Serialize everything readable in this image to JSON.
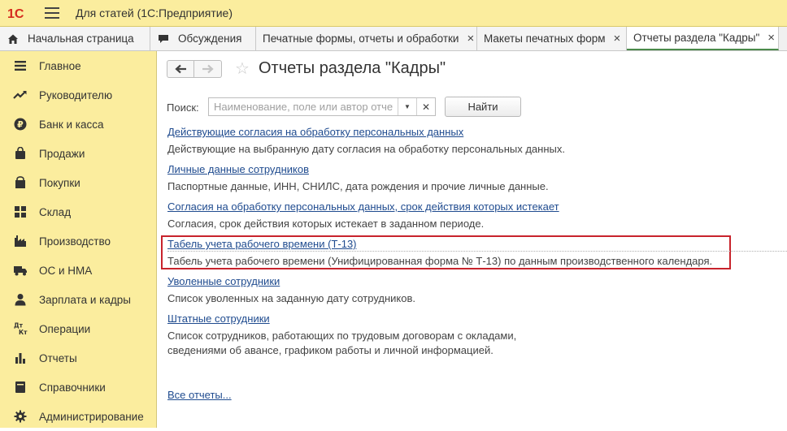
{
  "app": {
    "title": "Для статей  (1С:Предприятие)",
    "logo_text": "1С",
    "colors": {
      "accent": "#fbed9e",
      "link": "#1f4b8f",
      "highlight": "#c8232c",
      "active_tab": "#4a8a4a",
      "logo": "#d52b1e"
    }
  },
  "tabs": [
    {
      "label": "Начальная страница",
      "icon": "home-icon",
      "closable": false,
      "active": false
    },
    {
      "label": "Обсуждения",
      "icon": "chat-icon",
      "closable": false,
      "active": false
    },
    {
      "label": "Печатные формы, отчеты и обработки",
      "closable": true,
      "active": false
    },
    {
      "label": "Макеты печатных форм",
      "closable": true,
      "active": false
    },
    {
      "label": "Отчеты раздела \"Кадры\"",
      "closable": true,
      "active": true
    }
  ],
  "sidebar": {
    "items": [
      {
        "label": "Главное",
        "icon": "list-icon"
      },
      {
        "label": "Руководителю",
        "icon": "trend-icon"
      },
      {
        "label": "Банк и касса",
        "icon": "ruble-icon"
      },
      {
        "label": "Продажи",
        "icon": "bag-icon"
      },
      {
        "label": "Покупки",
        "icon": "cart-icon"
      },
      {
        "label": "Склад",
        "icon": "grid-icon"
      },
      {
        "label": "Производство",
        "icon": "factory-icon"
      },
      {
        "label": "ОС и НМА",
        "icon": "truck-icon"
      },
      {
        "label": "Зарплата и кадры",
        "icon": "person-icon"
      },
      {
        "label": "Операции",
        "icon": "dt-kt-icon",
        "icon_text_top": "Дт",
        "icon_text_bottom": "Кт"
      },
      {
        "label": "Отчеты",
        "icon": "bar-chart-icon"
      },
      {
        "label": "Справочники",
        "icon": "book-icon"
      },
      {
        "label": "Администрирование",
        "icon": "gear-icon"
      }
    ]
  },
  "page": {
    "title": "Отчеты раздела \"Кадры\"",
    "search": {
      "label": "Поиск:",
      "placeholder": "Наименование, поле или автор отчета",
      "value": "",
      "find_button": "Найти"
    },
    "reports": [
      {
        "title": "Действующие согласия на обработку персональных данных",
        "description": "Действующие на выбранную дату согласия на обработку персональных данных."
      },
      {
        "title": "Личные данные сотрудников",
        "description": "Паспортные данные, ИНН, СНИЛС, дата рождения и прочие личные данные."
      },
      {
        "title": "Согласия на обработку персональных данных, срок действия которых истекает",
        "description": "Согласия, срок действия которых истекает в заданном периоде."
      },
      {
        "title": "Табель учета рабочего времени (Т-13)",
        "description": "Табель учета рабочего времени (Унифицированная форма № Т-13) по данным производственного календаря.",
        "highlighted": true
      },
      {
        "title": "Уволенные сотрудники",
        "description": "Список уволенных на заданную дату сотрудников."
      },
      {
        "title": "Штатные сотрудники",
        "description": "Список сотрудников, работающих по трудовым договорам с окладами,\nсведениями об авансе, графиком работы и личной информацией."
      }
    ],
    "all_reports_link": "Все отчеты..."
  }
}
